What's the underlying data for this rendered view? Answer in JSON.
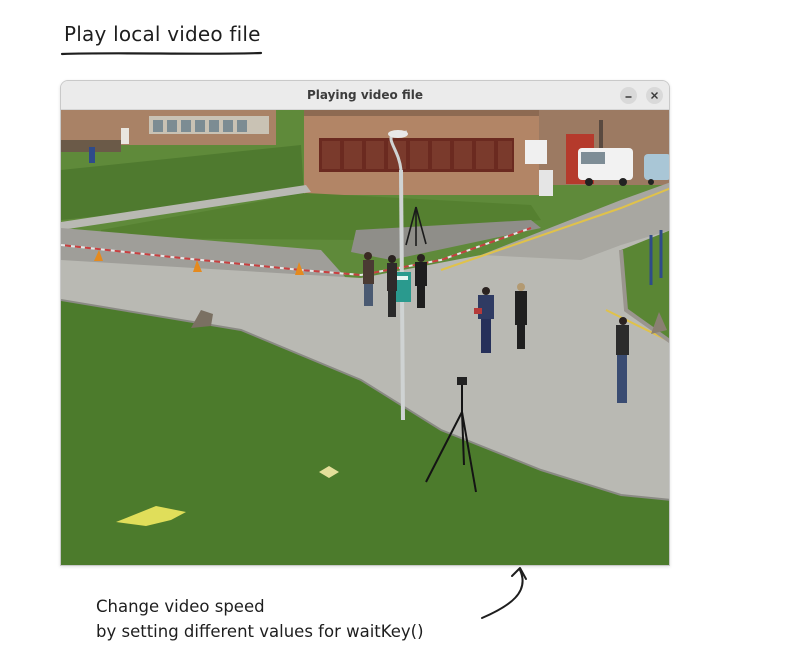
{
  "page": {
    "heading": "Play local video file"
  },
  "window": {
    "title": "Playing video file",
    "controls": {
      "minimize_icon": "minimize-icon",
      "close_icon": "close-icon"
    }
  },
  "annotation": {
    "line1": "Change video speed",
    "line2": "by setting different values for waitKey()"
  },
  "colors": {
    "text": "#1e1e1e",
    "titlebar": "#ebebeb",
    "grass": "#4f7a2f",
    "road": "#b9b9b3",
    "brick": "#b28566"
  }
}
